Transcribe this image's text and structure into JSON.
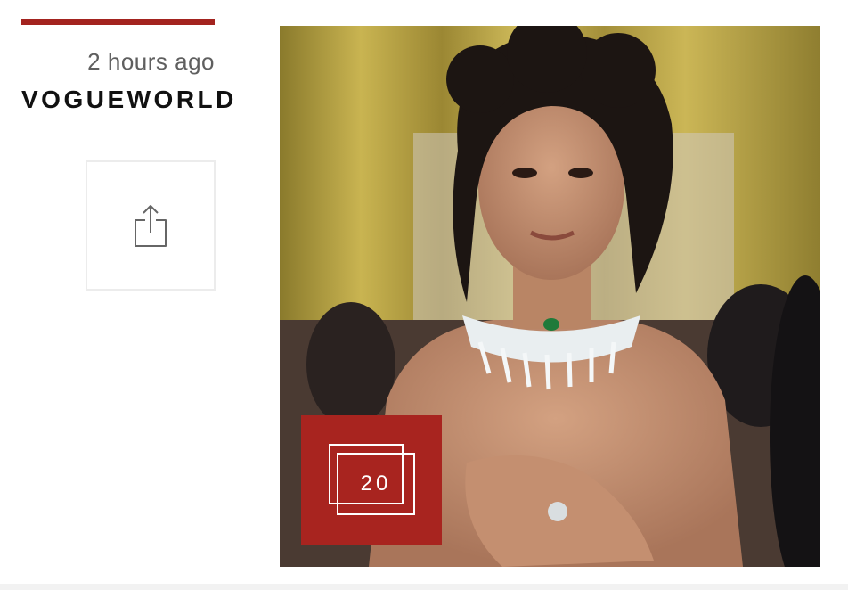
{
  "article": {
    "timestamp": "2 hours ago",
    "section": "VOGUEWORLD",
    "gallery_count": "20"
  },
  "icons": {
    "share": "share-icon",
    "gallery": "gallery-icon"
  },
  "colors": {
    "accent": "#a3231f",
    "badge": "#a8241f"
  }
}
